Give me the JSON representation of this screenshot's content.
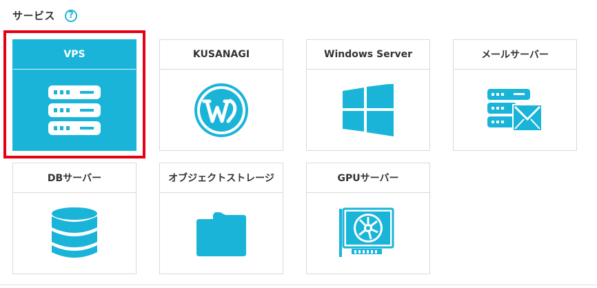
{
  "section": {
    "title": "サービス",
    "help_icon": "question-circle-icon",
    "help_symbol": "?"
  },
  "colors": {
    "accent": "#1ab4d9",
    "selection_outline": "#e60012",
    "border": "#d9d9d9"
  },
  "services": [
    {
      "label": "VPS",
      "icon": "server-rack-icon",
      "selected": true
    },
    {
      "label": "KUSANAGI",
      "icon": "wordpress-icon",
      "selected": false
    },
    {
      "label": "Windows Server",
      "icon": "windows-icon",
      "selected": false
    },
    {
      "label": "メールサーバー",
      "icon": "mail-server-icon",
      "selected": false
    },
    {
      "label": "DBサーバー",
      "icon": "database-icon",
      "selected": false
    },
    {
      "label": "オブジェクトストレージ",
      "icon": "folder-icon",
      "selected": false
    },
    {
      "label": "GPUサーバー",
      "icon": "gpu-card-icon",
      "selected": false
    }
  ]
}
